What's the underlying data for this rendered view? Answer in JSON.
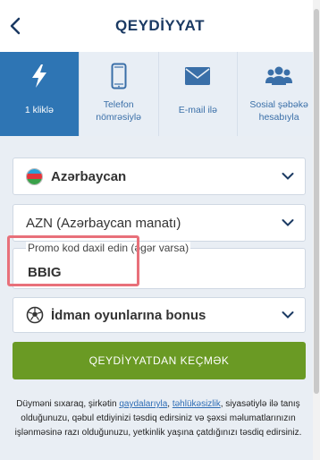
{
  "header": {
    "title": "QEYDİYYAT"
  },
  "tabs": [
    {
      "label": "1 kliklə",
      "icon": "lightning-icon"
    },
    {
      "label": "Telefon\nnömrəsiylə",
      "icon": "phone-icon"
    },
    {
      "label": "E-mail ilə",
      "icon": "envelope-icon"
    },
    {
      "label": "Sosial şəbəkə\nhesabıyla",
      "icon": "users-icon"
    }
  ],
  "form": {
    "country": "Azərbaycan",
    "currency": "AZN (Azərbaycan manatı)",
    "promo_label": "Promo kod daxil edin (əgər varsa)",
    "promo_value": "BBIG",
    "bonus": "İdman oyunlarına bonus",
    "submit": "QEYDİYYATDAN KEÇMƏK"
  },
  "terms": {
    "part1": "Düyməni sıxaraq, şirkətin ",
    "link1": "qaydalarıyla",
    "part2": ", ",
    "link2": "təhlükəsizlik",
    "part3": ", siyasətiylə ilə tanış olduğunuzu, qəbul etdiyinizi təsdiq edirsiniz və şəxsi məlumatlarınızın işlənməsinə razı olduğunuzu, yetkinlik yaşına çatdığınızı təsdiq edirsiniz."
  },
  "colors": {
    "title": "#1b3a63",
    "active_tab": "#2e75b4",
    "tab_bar": "#e8eef5",
    "submit": "#6a9a24",
    "highlight": "#e8707a",
    "link": "#2e6db5"
  }
}
